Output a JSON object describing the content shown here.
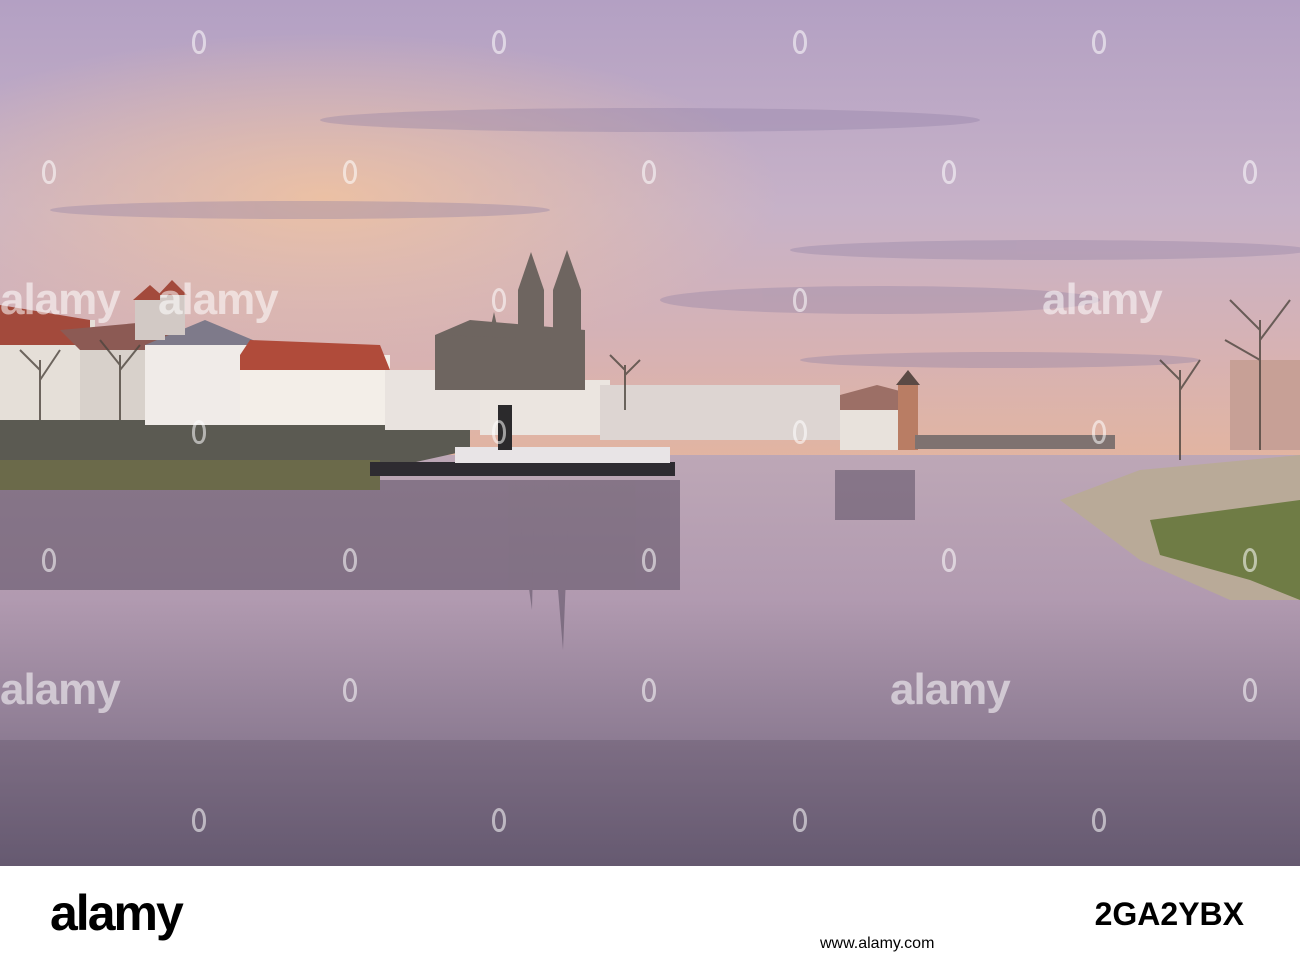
{
  "watermark": {
    "text": "alamy"
  },
  "footer": {
    "logo": "alamy",
    "image_id": "2GA2YBX",
    "domain": "www.alamy.com"
  },
  "colors": {
    "sky_top": "#b8a6c6",
    "sky_horizon": "#e9b79c",
    "water": "#8a7c9a",
    "brand_black": "#000000"
  }
}
